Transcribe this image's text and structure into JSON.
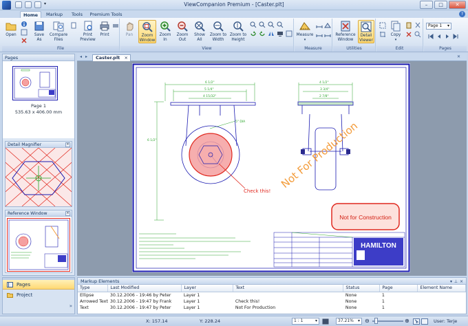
{
  "window": {
    "title": "ViewCompanion Premium - [Caster.plt]",
    "controls": [
      "minimize-icon",
      "maximize-icon",
      "close-icon"
    ]
  },
  "ribbon": {
    "tabs": [
      {
        "label": "Home",
        "active": true
      },
      {
        "label": "Markup"
      },
      {
        "label": "Tools"
      },
      {
        "label": "Premium Tools"
      }
    ],
    "groups": [
      {
        "label": "File",
        "buttons": [
          {
            "label": "Open"
          },
          {
            "label": "Save\nAs"
          },
          {
            "label": "Compare\nFiles"
          },
          {
            "label": "Print\nPreview"
          },
          {
            "label": "Print"
          }
        ]
      },
      {
        "label": "View",
        "buttons": [
          {
            "label": "Pan"
          },
          {
            "label": "Zoom\nWindow"
          },
          {
            "label": "Zoom\nIn"
          },
          {
            "label": "Zoom\nOut"
          },
          {
            "label": "Show\nAll"
          },
          {
            "label": "Zoom to\nWidth"
          },
          {
            "label": "Zoom to\nHeight"
          }
        ]
      },
      {
        "label": "Measure",
        "buttons": [
          {
            "label": "Measure"
          }
        ]
      },
      {
        "label": "Utilities",
        "buttons": [
          {
            "label": "Reference\nWindow"
          },
          {
            "label": "Detail\nViewer"
          }
        ]
      },
      {
        "label": "Edit",
        "buttons": [
          {
            "label": "Copy"
          }
        ]
      },
      {
        "label": "Pages",
        "select": "Page 1"
      }
    ]
  },
  "left_panel": {
    "title": "Pages",
    "thumbnail": {
      "label": "Page 1",
      "size": "535.63 x 406.00 mm"
    },
    "detail_magnifier": {
      "title": "Detail Magnifier"
    },
    "reference_window": {
      "title": "Reference Window"
    }
  },
  "nav": [
    {
      "label": "Pages",
      "active": true
    },
    {
      "label": "Project"
    }
  ],
  "document": {
    "tab": "Caster.plt",
    "drawing": {
      "annotations": [
        "Check this!",
        "Not For Production",
        "Not for Construction"
      ],
      "logo_text": "HAMILTON"
    }
  },
  "markup_panel": {
    "title": "Markup Elements",
    "columns": [
      "Type",
      "Last Modified",
      "Layer",
      "Text",
      "Status",
      "Page",
      "Element Name"
    ],
    "rows": [
      {
        "type": "Ellipse",
        "modified": "30.12.2006 - 19:46 by Peter",
        "layer": "Layer 1",
        "text": "",
        "status": "None",
        "page": "1",
        "name": ""
      },
      {
        "type": "Arrowed Text",
        "modified": "30.12.2006 - 19:47 by Frank",
        "layer": "Layer 1",
        "text": "Check this!",
        "status": "None",
        "page": "1",
        "name": ""
      },
      {
        "type": "Text",
        "modified": "30.12.2006 - 19:47 by Peter",
        "layer": "Layer 1",
        "text": "Not For Production",
        "status": "None",
        "page": "1",
        "name": ""
      }
    ]
  },
  "status": {
    "x": "X: 157.14",
    "y": "Y: 228.24",
    "scale": "1 : 1",
    "zoom": "37.21%",
    "user": "User: Terje"
  },
  "colors": {
    "accent": "#3a72c4",
    "highlight": "#ffd86e",
    "markup_red": "#e0281e",
    "markup_orange": "#f39c3b",
    "frame_blue": "#1a1ab0"
  }
}
